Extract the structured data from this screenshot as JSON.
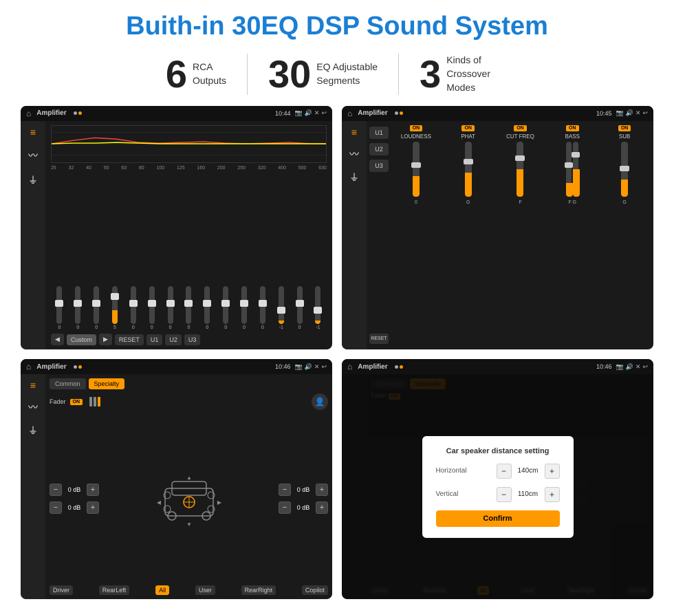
{
  "page": {
    "title": "Buith-in 30EQ DSP Sound System"
  },
  "stats": [
    {
      "number": "6",
      "desc_line1": "RCA",
      "desc_line2": "Outputs"
    },
    {
      "number": "30",
      "desc_line1": "EQ Adjustable",
      "desc_line2": "Segments"
    },
    {
      "number": "3",
      "desc_line1": "Kinds of",
      "desc_line2": "Crossover Modes"
    }
  ],
  "screens": [
    {
      "id": "eq-screen",
      "app_name": "Amplifier",
      "time": "10:44",
      "type": "eq"
    },
    {
      "id": "crossover-screen",
      "app_name": "Amplifier",
      "time": "10:45",
      "type": "crossover"
    },
    {
      "id": "fader-screen",
      "app_name": "Amplifier",
      "time": "10:46",
      "type": "fader"
    },
    {
      "id": "distance-screen",
      "app_name": "Amplifier",
      "time": "10:46",
      "type": "distance"
    }
  ],
  "eq": {
    "freq_labels": [
      "25",
      "32",
      "40",
      "50",
      "63",
      "80",
      "100",
      "125",
      "160",
      "200",
      "250",
      "320",
      "400",
      "500",
      "630"
    ],
    "values": [
      "0",
      "0",
      "0",
      "5",
      "0",
      "0",
      "0",
      "0",
      "0",
      "0",
      "0",
      "0",
      "-1",
      "0",
      "-1"
    ],
    "controls": {
      "preset": "Custom",
      "buttons": [
        "RESET",
        "U1",
        "U2",
        "U3"
      ]
    }
  },
  "crossover": {
    "u_buttons": [
      "U1",
      "U2",
      "U3"
    ],
    "channels": [
      {
        "label": "LOUDNESS",
        "on": true
      },
      {
        "label": "PHAT",
        "on": true
      },
      {
        "label": "CUT FREQ",
        "on": true
      },
      {
        "label": "BASS",
        "on": true
      },
      {
        "label": "SUB",
        "on": true
      }
    ],
    "reset_label": "RESET"
  },
  "fader": {
    "tabs": [
      "Common",
      "Specialty"
    ],
    "active_tab": "Specialty",
    "fader_label": "Fader",
    "on": true,
    "db_values": [
      "0 dB",
      "0 dB",
      "0 dB",
      "0 dB"
    ],
    "labels": {
      "driver": "Driver",
      "rear_left": "RearLeft",
      "all": "All",
      "user": "User",
      "rear_right": "RearRight",
      "copilot": "Copilot"
    }
  },
  "distance_dialog": {
    "title": "Car speaker distance setting",
    "horizontal_label": "Horizontal",
    "horizontal_value": "140cm",
    "vertical_label": "Vertical",
    "vertical_value": "110cm",
    "confirm_label": "Confirm"
  }
}
